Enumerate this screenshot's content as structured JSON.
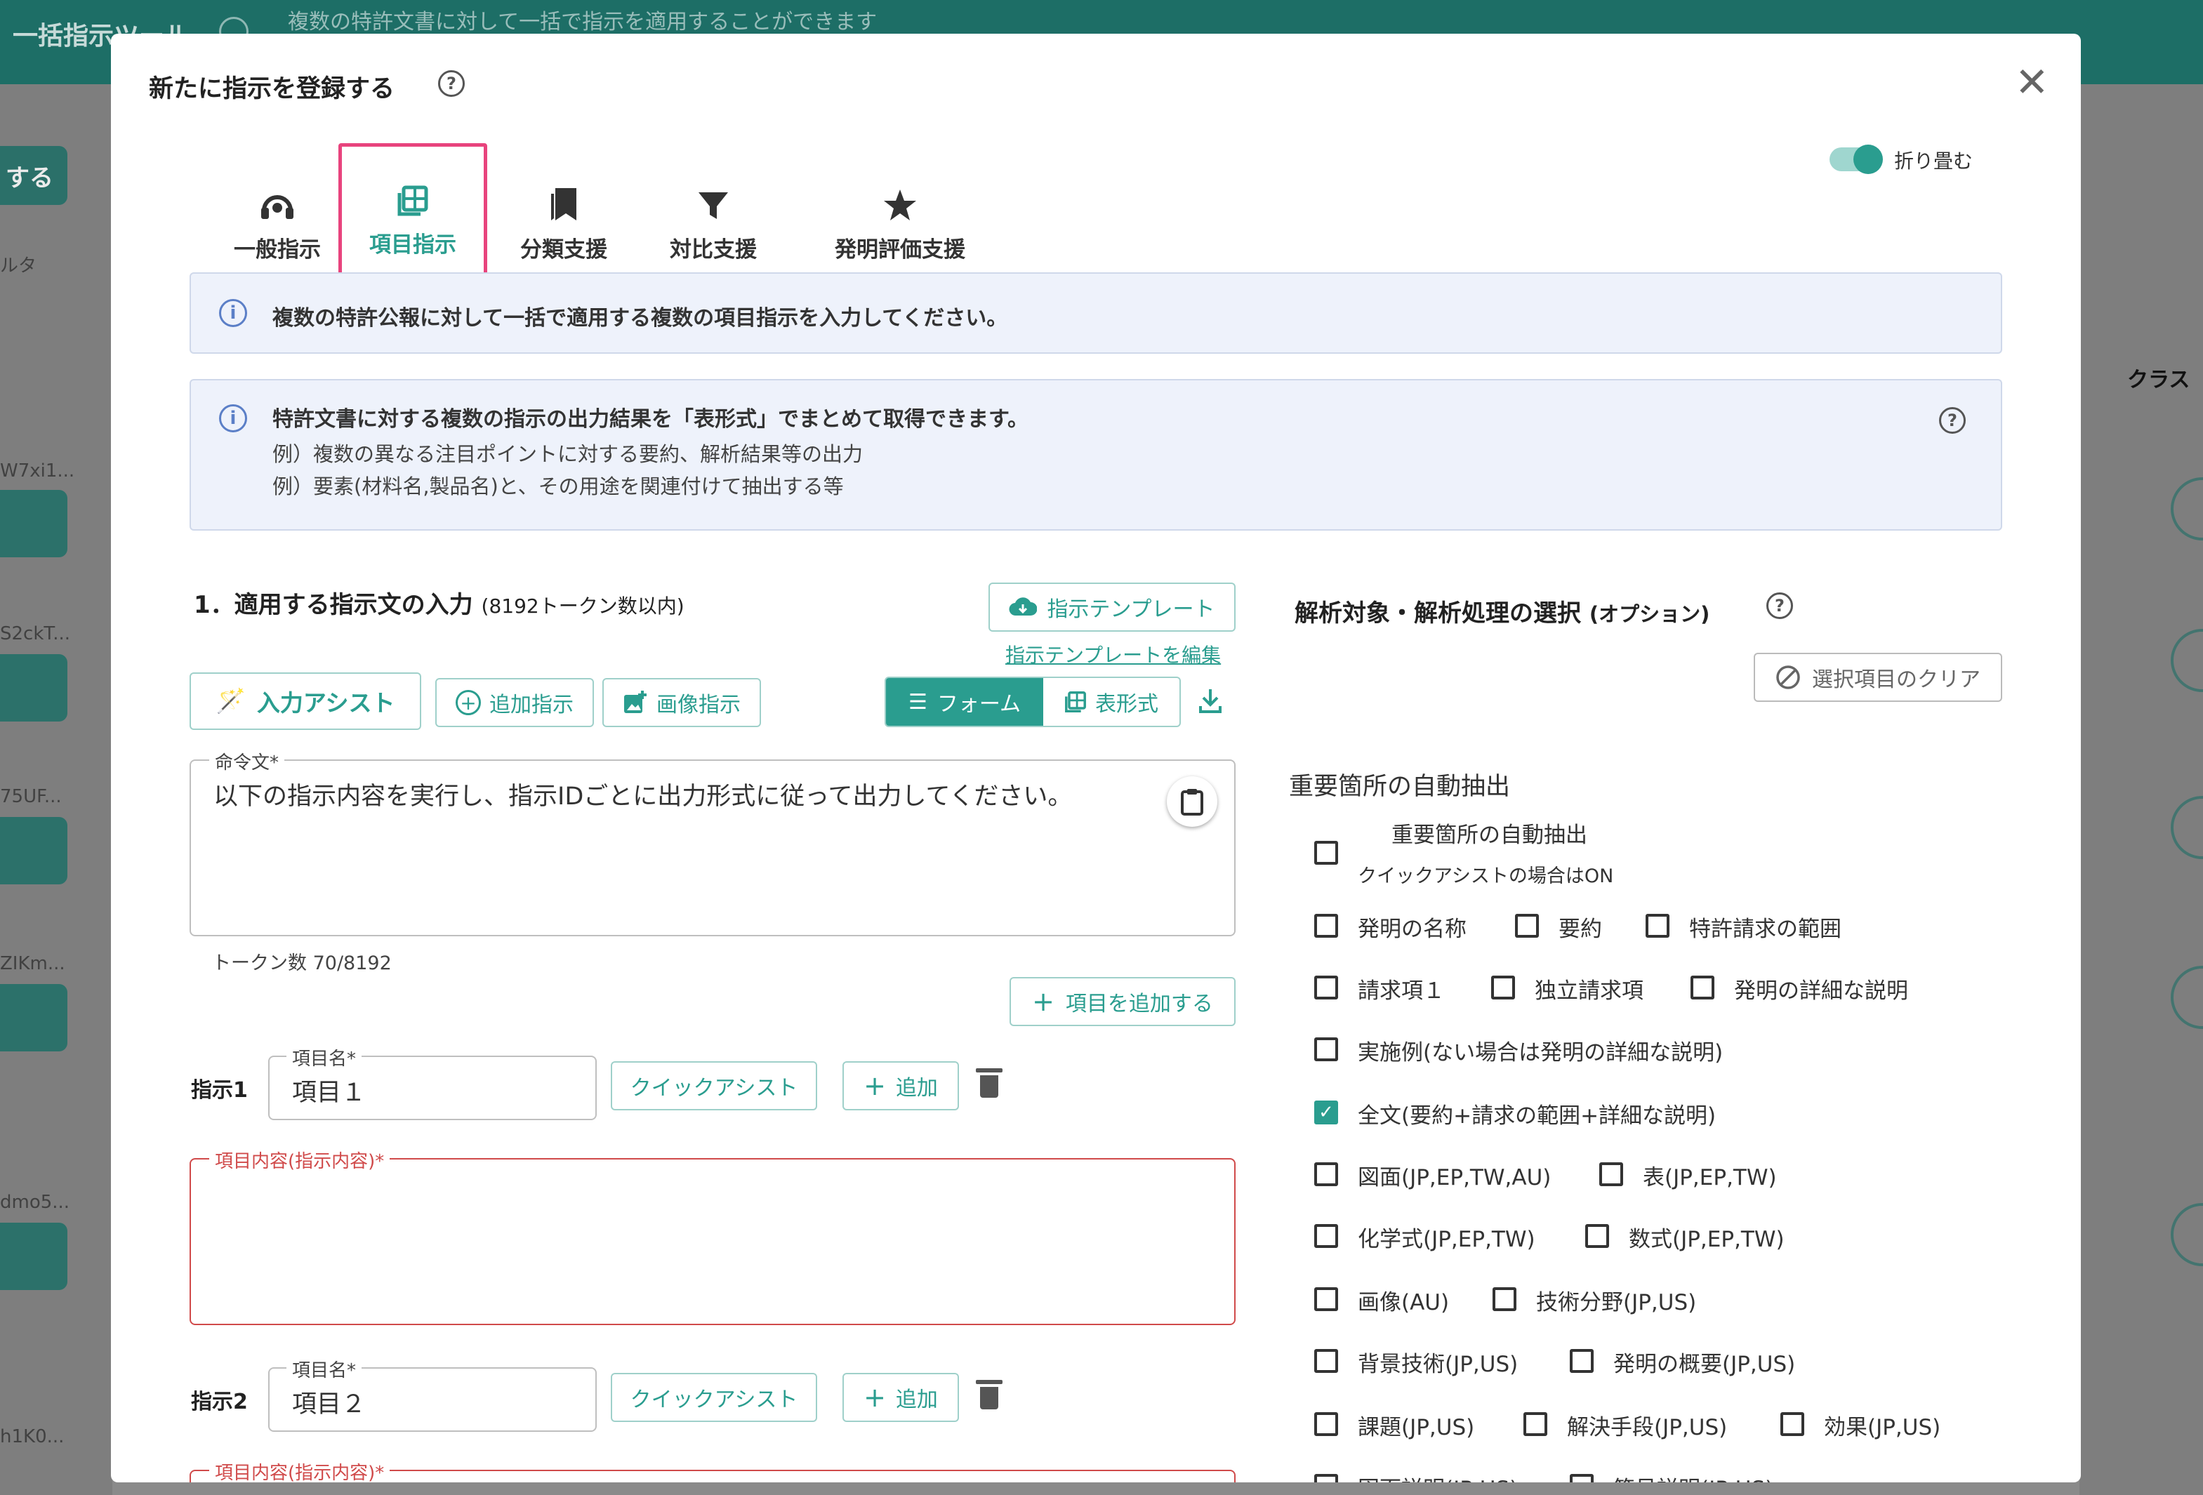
{
  "background": {
    "app_title": "一括指示ツール",
    "app_description": "複数の特許文書に対して一括で指示を適用することができます",
    "left_button_label": "する",
    "left_filter_label": "ルタ",
    "left_items": [
      "W7xi1...",
      "S2ckT...",
      "75UF...",
      "ZIKm...",
      "dmo5...",
      "h1K0..."
    ],
    "right_header": "クラス"
  },
  "modal": {
    "title": "新たに指示を登録する",
    "help_icon": "question-circle-icon",
    "close_icon": "close-icon",
    "collapse_label": "折り畳む",
    "collapse_on": true,
    "tabs": [
      {
        "label": "一般指示",
        "icon": "headset-icon",
        "active": false
      },
      {
        "label": "項目指示",
        "icon": "table-icon",
        "active": true
      },
      {
        "label": "分類支援",
        "icon": "bookmarks-icon",
        "active": false
      },
      {
        "label": "対比支援",
        "icon": "filter-icon",
        "active": false
      },
      {
        "label": "発明評価支援",
        "icon": "star-icon",
        "active": false
      }
    ],
    "info1": "複数の特許公報に対して一括で適用する複数の項目指示を入力してください。",
    "info2": {
      "title": "特許文書に対する複数の指示の出力結果を「表形式」でまとめて取得できます。",
      "line1": "例）複数の異なる注目ポイントに対する要約、解析結果等の出力",
      "line2": "例）要素(材料名,製品名)と、その用途を関連付けて抽出する等"
    },
    "left": {
      "section_title": "1．適用する指示文の入力",
      "section_note": "(8192トークン数以内)",
      "template_button": "指示テンプレート",
      "template_edit_link": "指示テンプレートを編集",
      "assist_button": "入力アシスト",
      "add_instruction_button": "追加指示",
      "image_instruction_button": "画像指示",
      "view_form": "フォーム",
      "view_table": "表形式",
      "command_label": "命令文*",
      "command_value": "以下の指示内容を実行し、指示IDごとに出力形式に従って出力してください。",
      "token_count": "トークン数 70/8192",
      "add_item_button": "項目を追加する",
      "items": [
        {
          "label": "指示1",
          "name_label": "項目名*",
          "name_value": "項目１",
          "quick_assist": "クイックアシスト",
          "add": "追加",
          "content_label": "項目内容(指示内容)*",
          "content_value": ""
        },
        {
          "label": "指示2",
          "name_label": "項目名*",
          "name_value": "項目２",
          "quick_assist": "クイックアシスト",
          "add": "追加",
          "content_label": "項目内容(指示内容)*",
          "content_value": ""
        }
      ]
    },
    "right": {
      "section_title": "解析対象・解析処理の選択",
      "section_note": "(オプション)",
      "clear_button": "選択項目のクリア",
      "auto_extract_heading": "重要箇所の自動抽出",
      "auto_extract": {
        "label": "重要箇所の自動抽出",
        "sub": "クイックアシストの場合はON",
        "checked": false
      },
      "rows": [
        [
          {
            "label": "発明の名称",
            "checked": false
          },
          {
            "label": "要約",
            "checked": false
          },
          {
            "label": "特許請求の範囲",
            "checked": false
          }
        ],
        [
          {
            "label": "請求項１",
            "checked": false
          },
          {
            "label": "独立請求項",
            "checked": false
          },
          {
            "label": "発明の詳細な説明",
            "checked": false
          }
        ],
        [
          {
            "label": "実施例(ない場合は発明の詳細な説明)",
            "checked": false
          }
        ],
        [
          {
            "label": "全文(要約+請求の範囲+詳細な説明)",
            "checked": true
          }
        ],
        [
          {
            "label": "図面(JP,EP,TW,AU)",
            "checked": false
          },
          {
            "label": "表(JP,EP,TW)",
            "checked": false
          }
        ],
        [
          {
            "label": "化学式(JP,EP,TW)",
            "checked": false
          },
          {
            "label": "数式(JP,EP,TW)",
            "checked": false
          }
        ],
        [
          {
            "label": "画像(AU)",
            "checked": false
          },
          {
            "label": "技術分野(JP,US)",
            "checked": false
          }
        ],
        [
          {
            "label": "背景技術(JP,US)",
            "checked": false
          },
          {
            "label": "発明の概要(JP,US)",
            "checked": false
          }
        ],
        [
          {
            "label": "課題(JP,US)",
            "checked": false
          },
          {
            "label": "解決手段(JP,US)",
            "checked": false
          },
          {
            "label": "効果(JP,US)",
            "checked": false
          }
        ],
        [
          {
            "label": "図面説明(JP,US)",
            "checked": false
          },
          {
            "label": "符号説明(JP,US)",
            "checked": false
          }
        ]
      ]
    }
  }
}
